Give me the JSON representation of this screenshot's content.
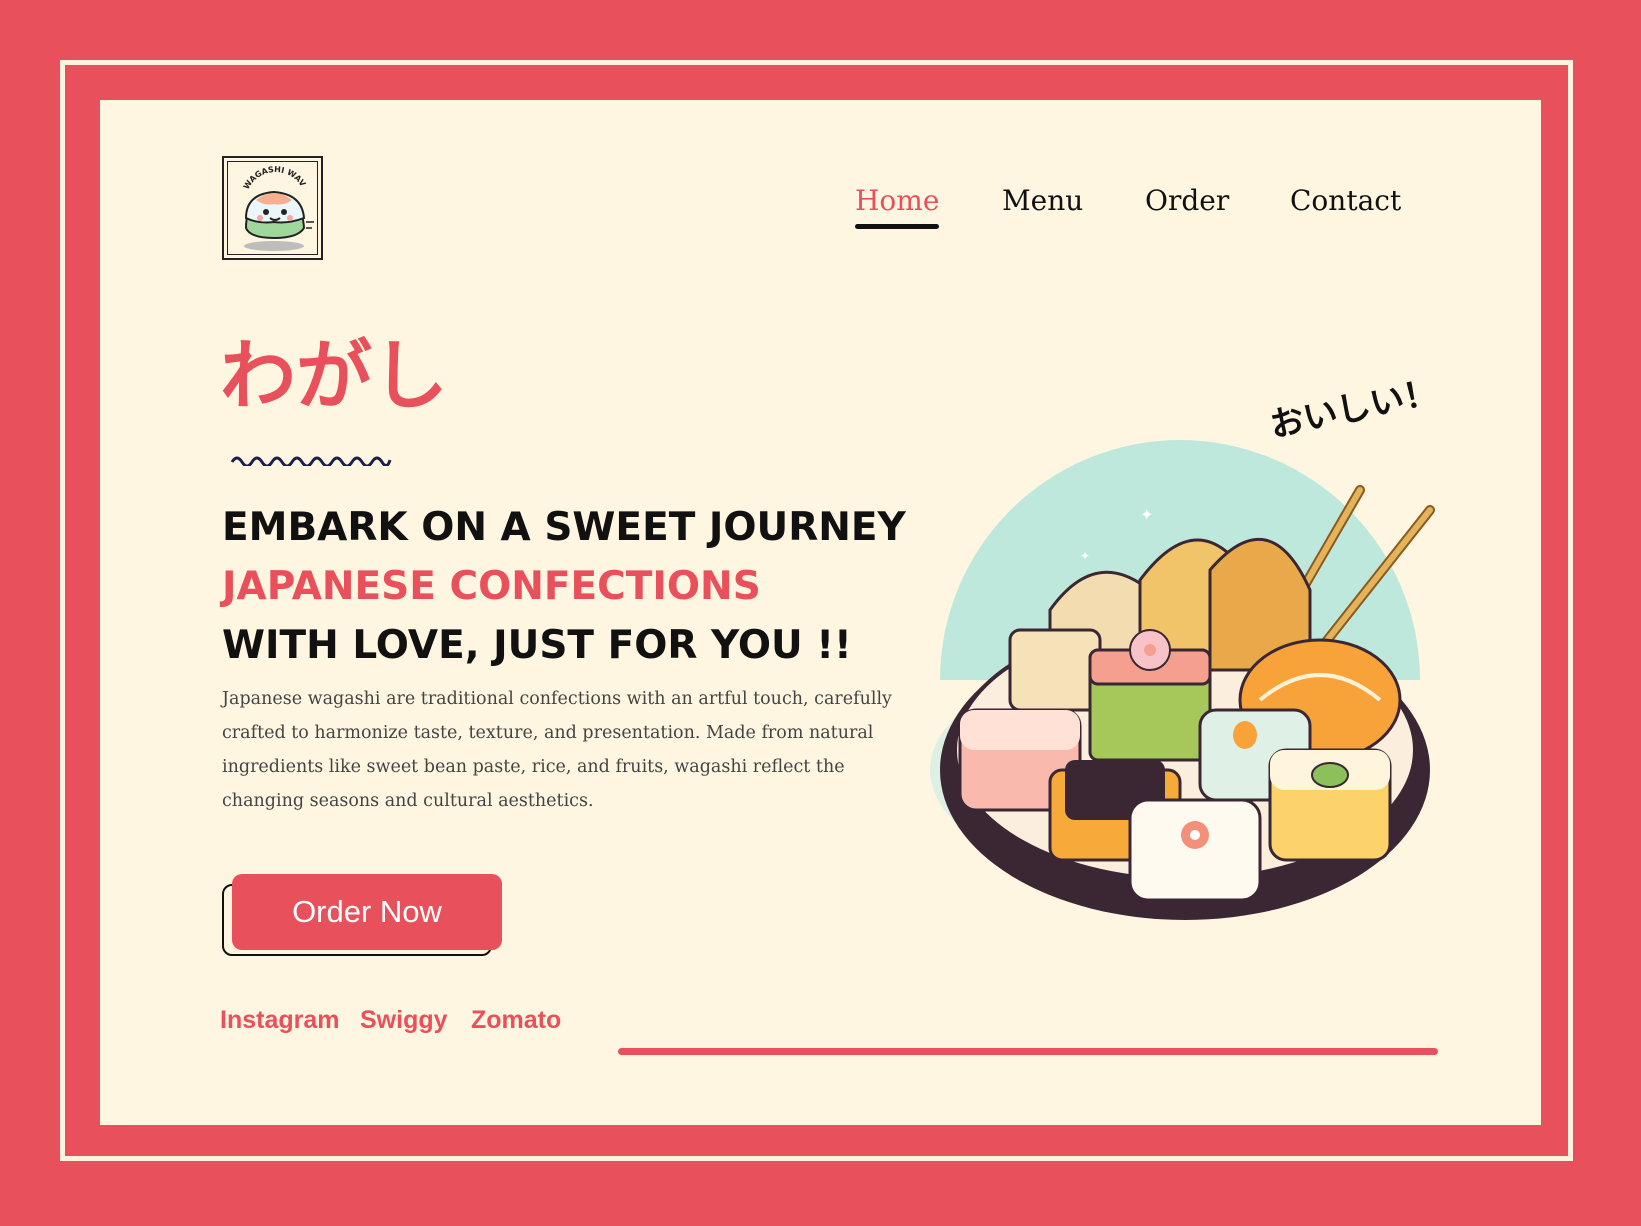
{
  "brand": {
    "logo_text": "WAGASHI WAVE"
  },
  "nav": {
    "items": [
      {
        "label": "Home",
        "active": true
      },
      {
        "label": "Menu",
        "active": false
      },
      {
        "label": "Order",
        "active": false
      },
      {
        "label": "Contact",
        "active": false
      }
    ]
  },
  "hero": {
    "jp_title": "わがし",
    "headline_line1": "EMBARK ON A SWEET JOURNEY",
    "headline_line2": "JAPANESE CONFECTIONS",
    "headline_line3": "WITH LOVE, JUST FOR YOU !!",
    "description": "Japanese wagashi are traditional confections with an artful touch, carefully crafted to harmonize taste, texture, and presentation. Made from natural ingredients like sweet bean paste, rice, and fruits, wagashi reflect the changing seasons and cultural aesthetics.",
    "cta_label": "Order Now",
    "image_caption": "おいしい！"
  },
  "social": {
    "links": [
      "Instagram",
      "Swiggy",
      "Zomato"
    ]
  },
  "colors": {
    "accent": "#e8515b",
    "background": "#fff6e1",
    "text": "#111111"
  }
}
